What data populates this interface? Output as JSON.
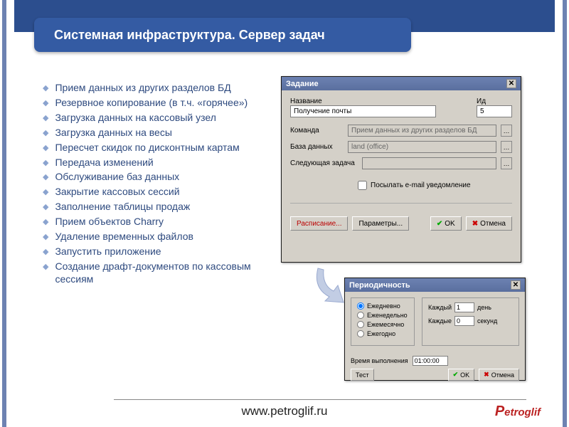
{
  "title": "Системная инфраструктура. Сервер задач",
  "bullets": [
    "Прием данных из других разделов БД",
    "Резервное копирование (в т.ч. «горячее»)",
    "Загрузка данных на кассовый узел",
    "Загрузка данных на весы",
    "Пересчет скидок по дисконтным картам",
    "Передача изменений",
    "Обслуживание баз данных",
    "Закрытие кассовых сессий",
    "Заполнение таблицы продаж",
    "Прием объектов Charry",
    "Удаление временных файлов",
    "Запустить приложение",
    "Создание драфт-документов по кассовым сессиям"
  ],
  "dlg1": {
    "title": "Задание",
    "labels": {
      "name": "Название",
      "id": "Ид",
      "command": "Команда",
      "db": "База данных",
      "next": "Следующая задача"
    },
    "values": {
      "name": "Получение почты",
      "id": "5",
      "command": "Прием данных из других разделов БД",
      "db": "land (office)",
      "next": ""
    },
    "checkbox": "Посылать e-mail уведомление",
    "buttons": {
      "schedule": "Расписание...",
      "params": "Параметры...",
      "ok": "OK",
      "cancel": "Отмена"
    }
  },
  "dlg2": {
    "title": "Периодичность",
    "radios": [
      "Ежедневно",
      "Еженедельно",
      "Ежемесячно",
      "Ежегодно"
    ],
    "every_n": {
      "label": "Каждый",
      "value": "1",
      "unit": "день"
    },
    "every_s": {
      "label": "Каждые",
      "value": "0",
      "unit": "секунд"
    },
    "time": {
      "label": "Время выполнения",
      "value": "01:00:00"
    },
    "buttons": {
      "test": "Тест",
      "ok": "OK",
      "cancel": "Отмена"
    }
  },
  "footer": {
    "url": "www.petroglif.ru",
    "brand": "etroglif",
    "brand_p": "P"
  }
}
